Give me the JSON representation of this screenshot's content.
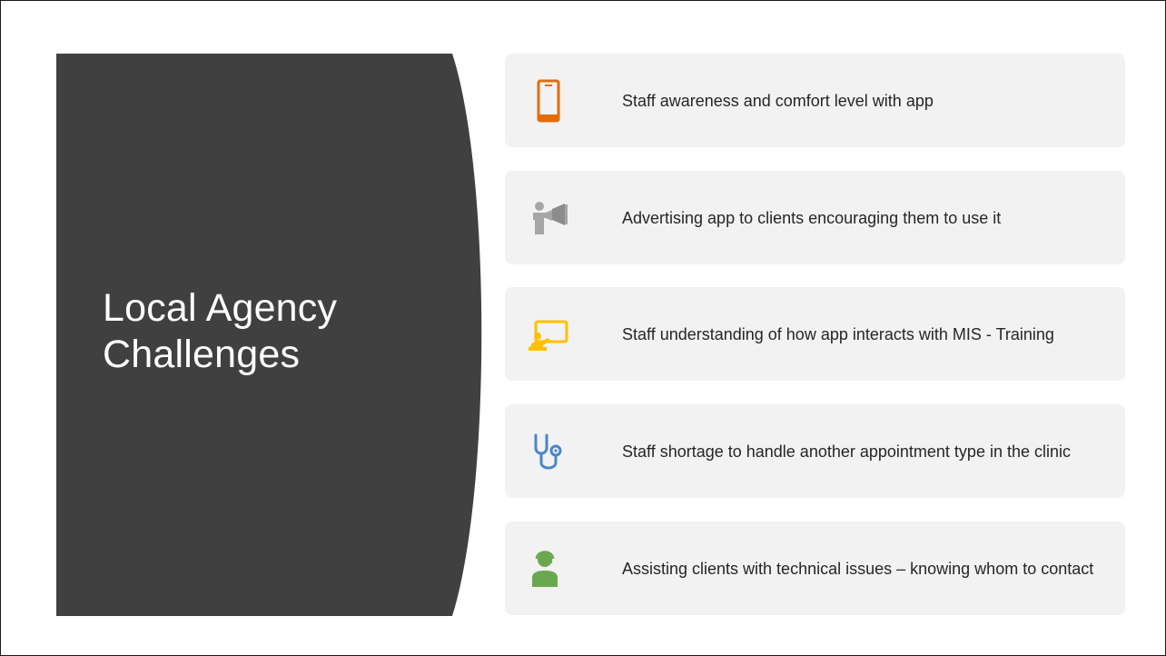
{
  "slide": {
    "title_line1": "Local Agency",
    "title_line2": "Challenges",
    "title_panel_color": "#404040",
    "card_color": "#f2f2f2"
  },
  "items": [
    {
      "icon": "smartphone-icon",
      "icon_color": "#e36c0a",
      "text": "Staff awareness and comfort level with app"
    },
    {
      "icon": "megaphone-person-icon",
      "icon_color": "#a6a6a6",
      "text": "Advertising app to clients encouraging them to use it"
    },
    {
      "icon": "training-presentation-icon",
      "icon_color": "#ffc000",
      "text": "Staff understanding of how app interacts with MIS - Training"
    },
    {
      "icon": "stethoscope-icon",
      "icon_color": "#4a86c8",
      "text": "Staff shortage to handle another appointment type in the clinic"
    },
    {
      "icon": "support-agent-icon",
      "icon_color": "#6aa84f",
      "text": "Assisting clients with technical issues – knowing whom to contact"
    }
  ]
}
